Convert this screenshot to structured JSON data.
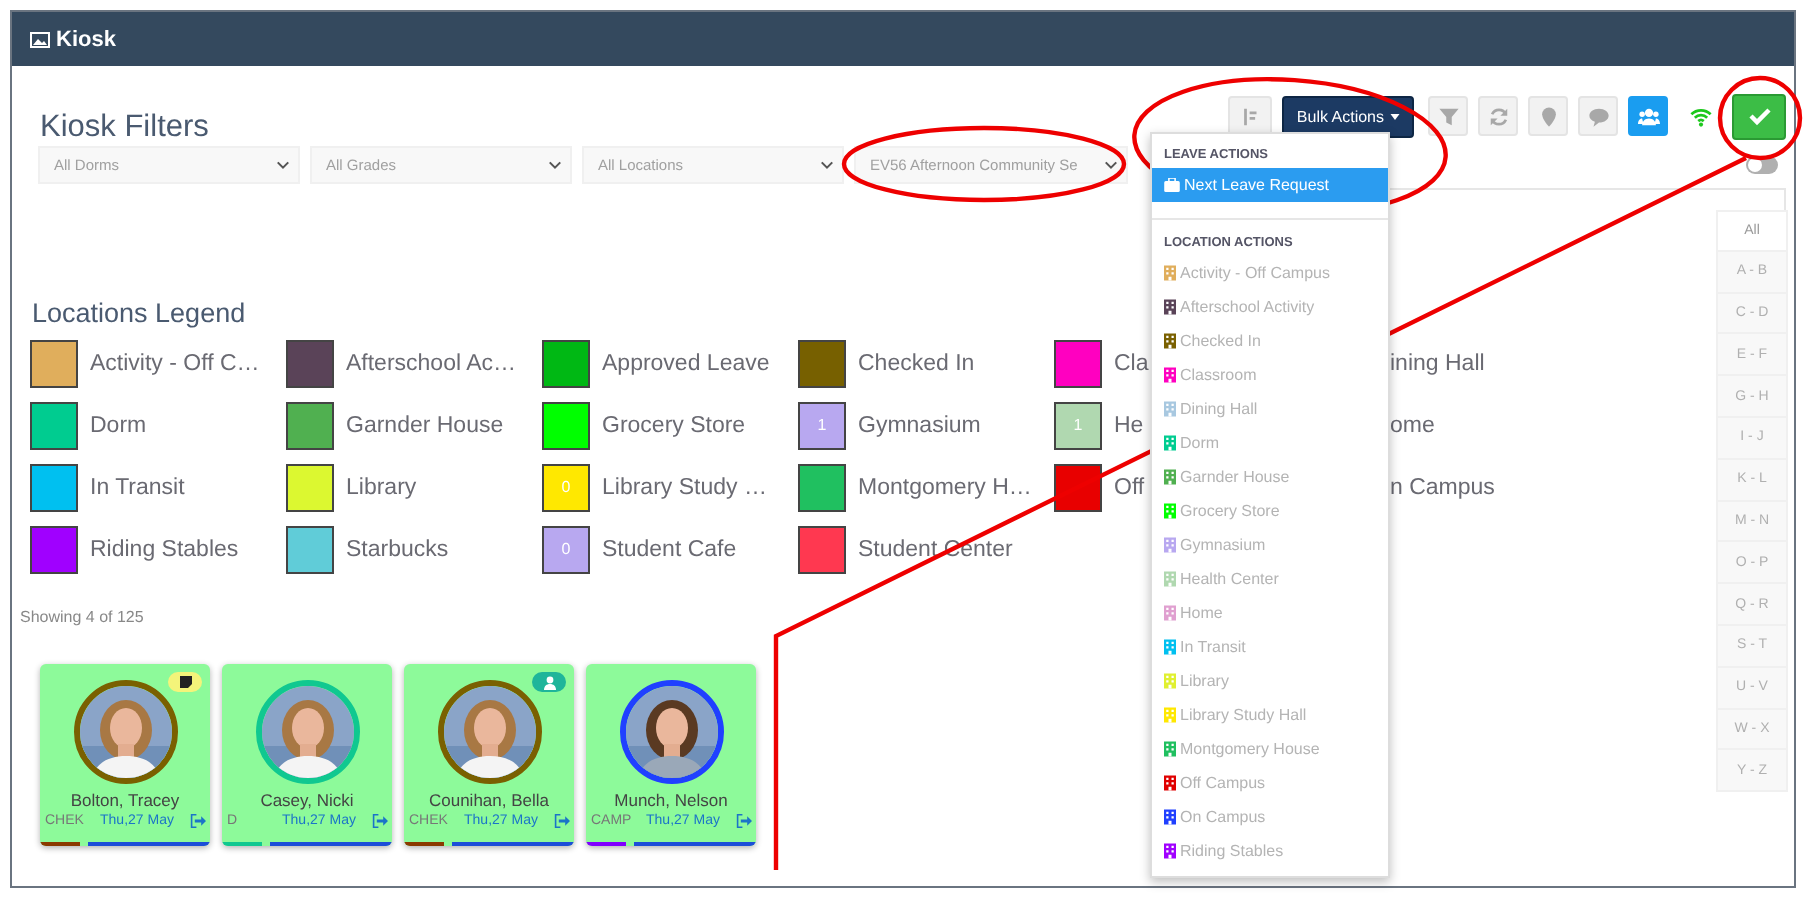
{
  "window": {
    "title": "Kiosk"
  },
  "page_title": "Kiosk Filters",
  "toolbar": [
    {
      "kind": "default"
    },
    {
      "kind": "dark",
      "label": "Bulk Actions"
    },
    {
      "kind": "default"
    },
    {
      "kind": "default"
    },
    {
      "kind": "default"
    },
    {
      "kind": "default"
    },
    {
      "kind": "info"
    },
    {
      "kind": "bare"
    },
    {
      "kind": "success"
    }
  ],
  "filters": [
    {
      "value": "All Dorms"
    },
    {
      "value": "All Grades"
    },
    {
      "value": "All Locations"
    },
    {
      "value": "EV56 Afternoon Community Se"
    }
  ],
  "toggle": {
    "on": false
  },
  "bulk_menu": {
    "sections": [
      {
        "title": "LEAVE ACTIONS",
        "items": [
          {
            "label": "Next Leave Request",
            "selected": true,
            "kind": "leave"
          }
        ]
      },
      {
        "title": "LOCATION ACTIONS",
        "items": [
          {
            "label": "Activity - Off Campus",
            "selected": false,
            "kind": "location",
            "color": "#e0ae5c"
          },
          {
            "label": "Afterschool Activity",
            "selected": false,
            "kind": "location",
            "color": "#5a4358"
          },
          {
            "label": "Checked In",
            "selected": false,
            "kind": "location",
            "color": "#7a6000"
          },
          {
            "label": "Classroom",
            "selected": false,
            "kind": "location",
            "color": "#ff00c0"
          },
          {
            "label": "Dining Hall",
            "selected": false,
            "kind": "location",
            "color": "#a8c8e0"
          },
          {
            "label": "Dorm",
            "selected": false,
            "kind": "location",
            "color": "#00cc90"
          },
          {
            "label": "Garnder House",
            "selected": false,
            "kind": "location",
            "color": "#50b050"
          },
          {
            "label": "Grocery Store",
            "selected": false,
            "kind": "location",
            "color": "#00ff00"
          },
          {
            "label": "Gymnasium",
            "selected": false,
            "kind": "location",
            "color": "#b8a8f0"
          },
          {
            "label": "Health Center",
            "selected": false,
            "kind": "location",
            "color": "#b0d8b0"
          },
          {
            "label": "Home",
            "selected": false,
            "kind": "location",
            "color": "#e0a0d0"
          },
          {
            "label": "In Transit",
            "selected": false,
            "kind": "location",
            "color": "#00c0f0"
          },
          {
            "label": "Library",
            "selected": false,
            "kind": "location",
            "color": "#e0f030"
          },
          {
            "label": "Library Study Hall",
            "selected": false,
            "kind": "location",
            "color": "#ffe800"
          },
          {
            "label": "Montgomery House",
            "selected": false,
            "kind": "location",
            "color": "#20c060"
          },
          {
            "label": "Off Campus",
            "selected": false,
            "kind": "location",
            "color": "#e00000"
          },
          {
            "label": "On Campus",
            "selected": false,
            "kind": "location",
            "color": "#2040ff"
          },
          {
            "label": "Riding Stables",
            "selected": false,
            "kind": "location",
            "color": "#a000ff"
          }
        ]
      }
    ]
  },
  "legend": {
    "title": "Locations Legend",
    "items": [
      {
        "label": "Activity - Off C…",
        "color": "#e0ae5c"
      },
      {
        "label": "Afterschool Ac…",
        "color": "#5a4358"
      },
      {
        "label": "Approved Leave",
        "color": "#00b814"
      },
      {
        "label": "Checked In",
        "color": "#776000"
      },
      {
        "label": "Cla",
        "color": "#ff00c0"
      },
      {
        "label": "ining Hall"
      },
      {
        "label": "Dorm",
        "color": "#00cc90"
      },
      {
        "label": "Garnder House",
        "color": "#50b050"
      },
      {
        "label": "Grocery Store",
        "color": "#00ff00"
      },
      {
        "label": "Gymnasium",
        "color": "#b8a8f0",
        "count": "1"
      },
      {
        "label": "He",
        "color": "#b0d8b0",
        "count": "1"
      },
      {
        "label": "ome"
      },
      {
        "label": "In Transit",
        "color": "#00c0f0"
      },
      {
        "label": "Library",
        "color": "#dcf830"
      },
      {
        "label": "Library Study …",
        "color": "#ffe800",
        "count": "0"
      },
      {
        "label": "Montgomery H…",
        "color": "#20c060"
      },
      {
        "label": "Off",
        "color": "#e80000"
      },
      {
        "label": "n Campus"
      },
      {
        "label": "Riding Stables",
        "color": "#a000ff"
      },
      {
        "label": "Starbucks",
        "color": "#60ccd8"
      },
      {
        "label": "Student Cafe",
        "color": "#b8a8f0",
        "count": "0"
      },
      {
        "label": "Student Center",
        "color": "#ff3850"
      }
    ]
  },
  "showing": "Showing 4 of 125",
  "students": [
    {
      "name": "Bolton, Tracey",
      "code": "CHEK",
      "date": "Thu,27 May",
      "avatar": {
        "color": "#7a6000"
      },
      "color": "#8a3a00",
      "badge": {
        "kind": "note"
      }
    },
    {
      "name": "Casey, Nicki",
      "code": "D",
      "date": "Thu,27 May",
      "avatar": {
        "color": "#10c890"
      },
      "color": "#10c890"
    },
    {
      "name": "Counihan, Bella",
      "code": "CHEK",
      "date": "Thu,27 May",
      "avatar": {
        "color": "#7a6000"
      },
      "color": "#8a3a00",
      "badge": {
        "kind": "person"
      }
    },
    {
      "name": "Munch, Nelson",
      "code": "CAMP",
      "date": "Thu,27 May",
      "avatar": {
        "color": "#2040ff"
      },
      "color": "#8000ff"
    }
  ],
  "alphabet": [
    {
      "label": "All",
      "selected": true
    },
    {
      "label": "A - B",
      "selected": false
    },
    {
      "label": "C - D",
      "selected": false
    },
    {
      "label": "E - F",
      "selected": false
    },
    {
      "label": "G - H",
      "selected": false
    },
    {
      "label": "I - J",
      "selected": false
    },
    {
      "label": "K - L",
      "selected": false
    },
    {
      "label": "M - N",
      "selected": false
    },
    {
      "label": "O - P",
      "selected": false
    },
    {
      "label": "Q - R",
      "selected": false
    },
    {
      "label": "S - T",
      "selected": false
    },
    {
      "label": "U - V",
      "selected": false
    },
    {
      "label": "W - X",
      "selected": false
    },
    {
      "label": "Y - Z",
      "selected": false
    }
  ]
}
